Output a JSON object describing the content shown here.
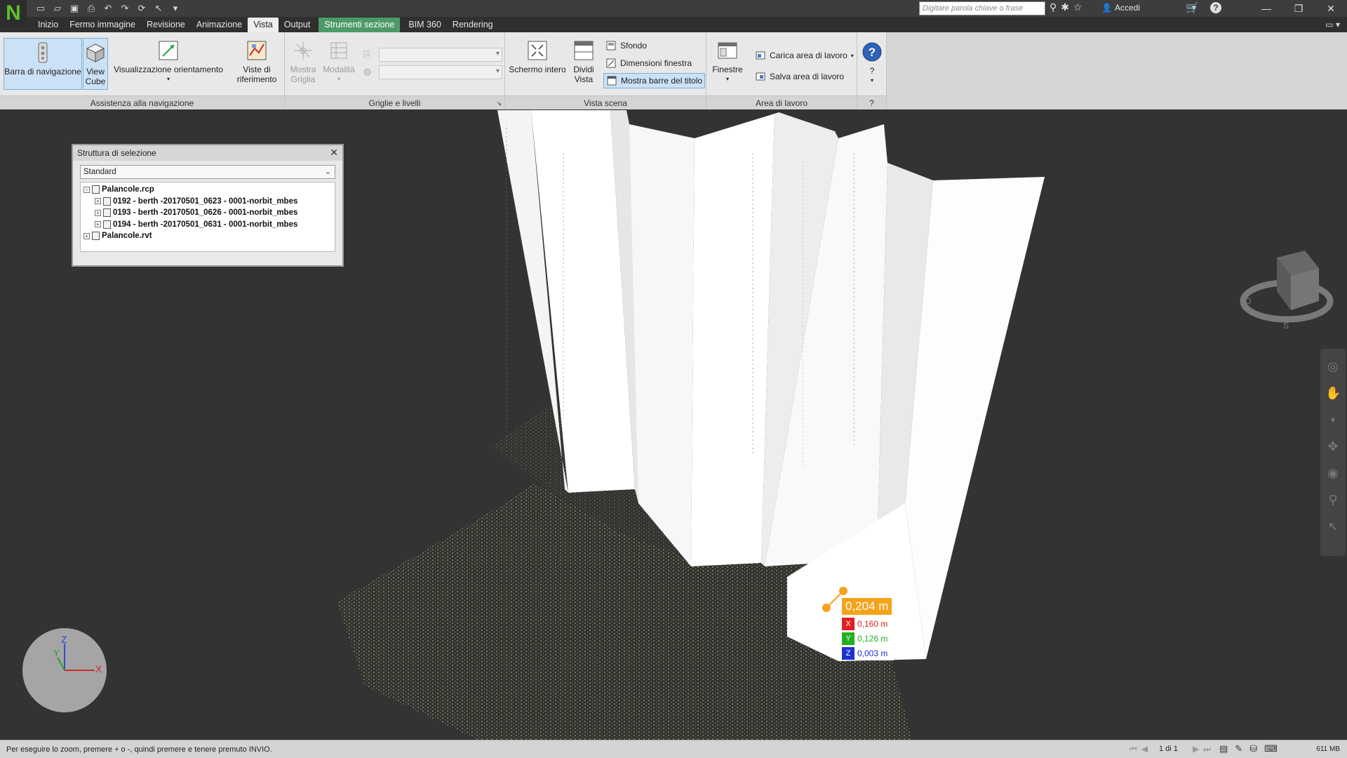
{
  "app": {
    "logo": "N",
    "title": ""
  },
  "search": {
    "placeholder": "Digitare parola chiave o frase"
  },
  "signin": {
    "label": "Accedi"
  },
  "qat": {
    "icons": [
      "new-icon",
      "open-icon",
      "save-icon",
      "print-icon",
      "undo-icon",
      "redo-icon",
      "refresh-icon",
      "select-icon"
    ]
  },
  "tabs": [
    {
      "label": "Inizio"
    },
    {
      "label": "Fermo immagine"
    },
    {
      "label": "Revisione"
    },
    {
      "label": "Animazione"
    },
    {
      "label": "Vista"
    },
    {
      "label": "Output"
    },
    {
      "label": "Strumenti sezione"
    },
    {
      "label": "BIM 360"
    },
    {
      "label": "Rendering"
    }
  ],
  "ribbon": {
    "groups": {
      "navigation_assist": "Assistenza alla navigazione",
      "grids_levels": "Griglie e livelli",
      "scene_view": "Vista scena",
      "workspace": "Area di lavoro",
      "help": "?"
    },
    "nav_bar_btn": "Barra di navigazione",
    "viewcube_btn": "View Cube",
    "orientation_btn": "Visualizzazione orientamento",
    "ref_views_btn": "Viste di riferimento",
    "show_grid_btn": "Mostra Griglia",
    "mode_btn": "Modalità",
    "fullscreen_btn": "Schermo intero",
    "split_view_btn": "Dividi Vista",
    "background_btn": "Sfondo",
    "window_size_btn": "Dimensioni finestra",
    "show_title_bars_btn": "Mostra barre del titolo",
    "windows_btn": "Finestre",
    "load_workspace_btn": "Carica area di lavoro",
    "save_workspace_btn": "Salva area di lavoro",
    "help_btn": "?"
  },
  "seltree": {
    "title": "Struttura di selezione",
    "mode": "Standard",
    "nodes": [
      {
        "label": "Palancole.rcp",
        "level": 0,
        "expanded": true
      },
      {
        "label": "0192 - berth -20170501_0623 - 0001-norbit_mbes",
        "level": 1,
        "expanded": false
      },
      {
        "label": "0193 - berth -20170501_0626 - 0001-norbit_mbes",
        "level": 1,
        "expanded": false
      },
      {
        "label": "0194 - berth -20170501_0631 - 0001-norbit_mbes",
        "level": 1,
        "expanded": false
      },
      {
        "label": "Palancole.rvt",
        "level": 0,
        "expanded": false
      }
    ]
  },
  "measurement": {
    "total": "0,204 m",
    "x": {
      "axis": "X",
      "value": "0,160 m",
      "color": "#e02020"
    },
    "y": {
      "axis": "Y",
      "value": "0,126 m",
      "color": "#20b020"
    },
    "z": {
      "axis": "Z",
      "value": "0,003 m",
      "color": "#2030d0"
    },
    "accent": "#f5a31a"
  },
  "axes": {
    "x": "X",
    "y": "Y",
    "z": "Z"
  },
  "status": {
    "message": "Per eseguire lo zoom, premere + o -, quindi premere e tenere premuto INVIO.",
    "page": "1 di 1",
    "memory": "611 MB"
  }
}
